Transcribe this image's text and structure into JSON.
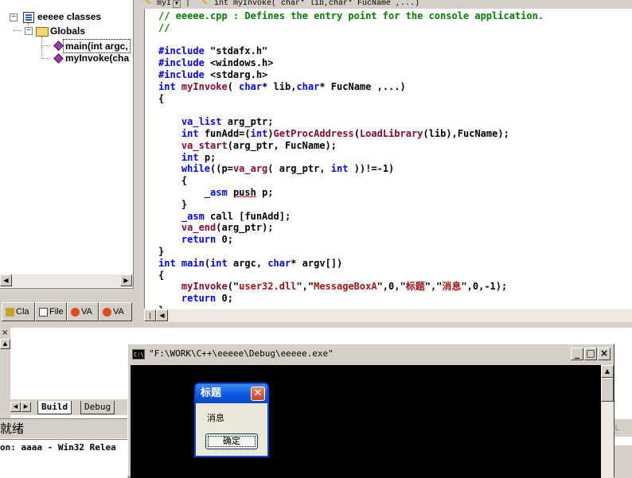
{
  "workspace": {
    "root_label": "eeeee classes",
    "globals_label": "Globals",
    "functions": [
      "main(int argc,",
      "myInvoke(cha"
    ],
    "tabs": [
      "Cla",
      "File",
      "VA",
      "VA"
    ]
  },
  "editor": {
    "signature_prefix": "myI",
    "signature": "int myInvoke( char* lib,char* FucName ,...)"
  },
  "output": {
    "tabs": [
      "Build",
      "Debug"
    ]
  },
  "status": {
    "text": "就绪",
    "config": "on: aaaa - Win32 Relea",
    "right_indicator": "OL"
  },
  "console": {
    "title": "\"F:\\WORK\\C++\\eeeee\\Debug\\eeeee.exe\""
  },
  "messagebox": {
    "title": "标题",
    "message": "消息",
    "ok_label": "确定"
  },
  "colors": {
    "comment": "#008000",
    "keyword": "#0000ff",
    "function": "#8b0a2b",
    "xp_title_blue": "#0a55e0"
  }
}
